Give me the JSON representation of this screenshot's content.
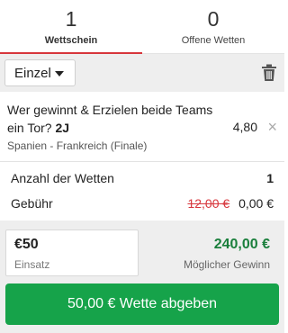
{
  "tabs": [
    {
      "count": "1",
      "label": "Wettschein"
    },
    {
      "count": "0",
      "label": "Offene Wetten"
    }
  ],
  "toolbar": {
    "mode": "Einzel"
  },
  "bet": {
    "question": "Wer gewinnt & Erzielen beide Teams ein Tor?",
    "selection": "2J",
    "odds": "4,80",
    "event": "Spanien - Frankreich (Finale)",
    "close_glyph": "×"
  },
  "summary": {
    "bets_count_label": "Anzahl der Wetten",
    "bets_count": "1",
    "fee_label": "Gebühr",
    "fee_old": "12,00 €",
    "fee_new": "0,00 €"
  },
  "stake": {
    "amount": "€50",
    "label": "Einsatz",
    "potential_win": "240,00 €",
    "potential_win_label": "Möglicher Gewinn"
  },
  "place_button": "50,00 € Wette abgeben",
  "colors": {
    "accent": "#d7363c",
    "win": "#1a7f3c",
    "button": "#16a34a"
  }
}
